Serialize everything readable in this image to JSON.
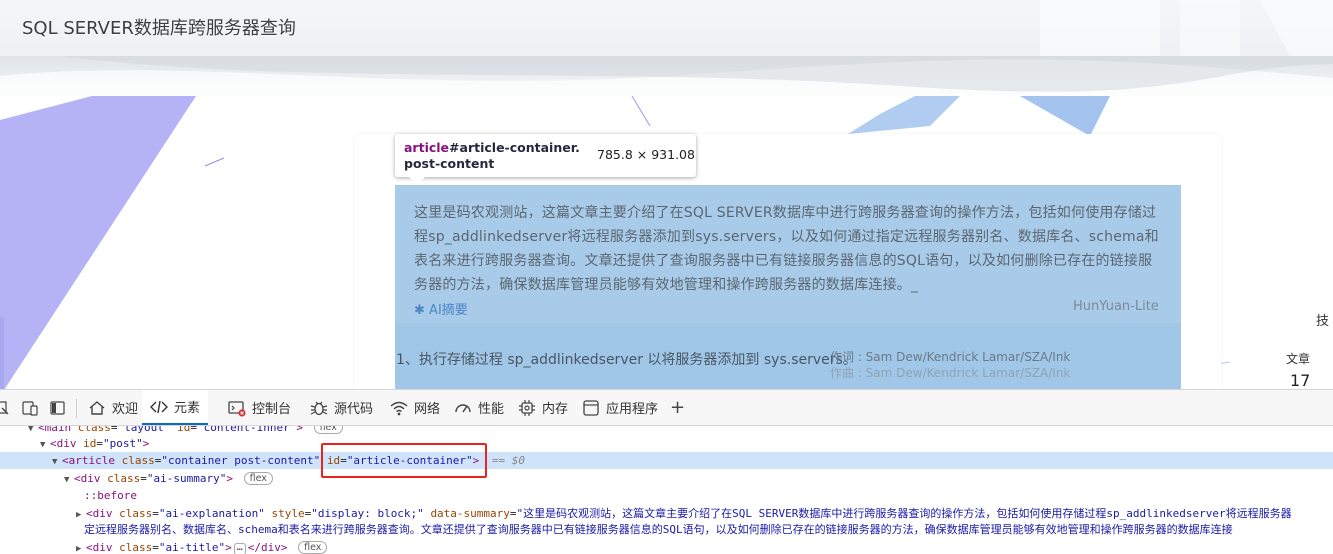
{
  "page": {
    "title": "SQL SERVER数据库跨服务器查询"
  },
  "article": {
    "summary": "这里是码农观测站，这篇文章主要介绍了在SQL SERVER数据库中进行跨服务器查询的操作方法，包括如何使用存储过程sp_addlinkedserver将远程服务器添加到sys.servers，以及如何通过指定远程服务器别名、数据库名、schema和表名来进行跨服务器查询。文章还提供了查询服务器中已有链接服务器信息的SQL语句，以及如何删除已存在的链接服务器的方法，确保数据库管理员能够有效地管理和操作跨服务器的数据库连接。_",
    "ai_label": "AI摘要",
    "ai_model": "HunYuan-Lite",
    "step1": "1、执行存储过程 sp_addlinkedserver 以将服务器添加到 sys.servers。",
    "lyric_line1": "作词 : Sam Dew/Kendrick Lamar/SZA/Ink",
    "lyric_line2": "作曲 : Sam Dew/Kendrick Lamar/SZA/Ink"
  },
  "sidebar": {
    "label_partial": "技",
    "stat_label": "文章",
    "stat_value": "17"
  },
  "tooltip": {
    "tag": "article",
    "selector": "#article-container.post-content",
    "dimensions": "785.8 × 931.08"
  },
  "devtools": {
    "tabs": [
      {
        "label": "欢迎",
        "icon": "home-icon"
      },
      {
        "label": "元素",
        "icon": "code-icon",
        "active": true
      },
      {
        "label": "控制台",
        "icon": "console-icon"
      },
      {
        "label": "源代码",
        "icon": "bug-icon"
      },
      {
        "label": "网络",
        "icon": "wifi-icon"
      },
      {
        "label": "性能",
        "icon": "gauge-icon"
      },
      {
        "label": "内存",
        "icon": "chip-icon"
      },
      {
        "label": "应用程序",
        "icon": "app-icon"
      }
    ],
    "add_tab": "+",
    "dom": {
      "row0": {
        "tag": "main",
        "cls_attr": "class",
        "cls_val": "\"layout\"",
        "id_attr": "id",
        "id_val": "\"content-inner\"",
        "badge": "flex"
      },
      "row1": {
        "tag": "div",
        "id_attr": "id",
        "id_val": "\"post\""
      },
      "row2": {
        "tag": "article",
        "cls_attr": "class",
        "cls_val": "\"container post-content\"",
        "id_attr": "id",
        "id_val": "\"article-container\"",
        "eq": "== $0"
      },
      "row3": {
        "tag": "div",
        "cls_attr": "class",
        "cls_val": "\"ai-summary\"",
        "badge": "flex"
      },
      "row4": {
        "pseudo": "::before"
      },
      "row5": {
        "tag": "div",
        "cls_attr": "class",
        "cls_val": "\"ai-explanation\"",
        "style_attr": "style",
        "style_val": "\"display: block;\"",
        "ds_attr": "data-summary",
        "ds_val": "\"这里是码农观测站，这篇文章主要介绍了在SQL SERVER数据库中进行跨服务器查询的操作方法，包括如何使用存储过程sp_addlinkedserver将远程服务器",
        "cont": "定远程服务器别名、数据库名、schema和表名来进行跨服务器查询。文章还提供了查询服务器中已有链接服务器信息的SQL语句，以及如何删除已存在的链接服务器的方法，确保数据库管理员能够有效地管理和操作跨服务器的数据库连接"
      },
      "row6": {
        "tag": "div",
        "cls_attr": "class",
        "cls_val": "\"ai-title\"",
        "dots": "…",
        "close": "</div>",
        "badge": "flex"
      }
    }
  }
}
